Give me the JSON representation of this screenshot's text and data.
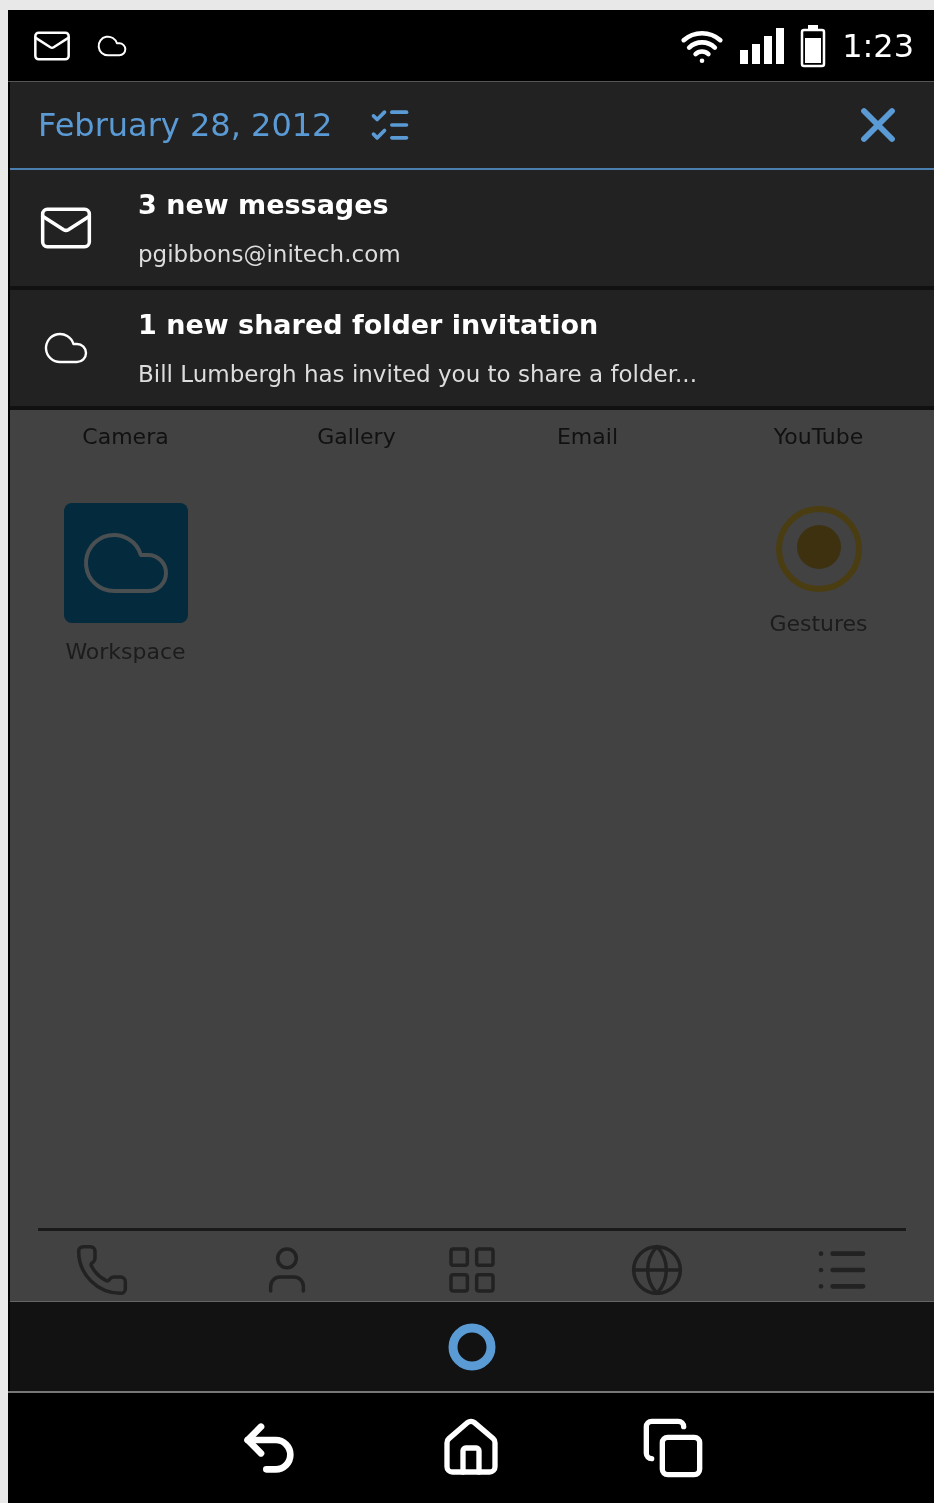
{
  "status_bar": {
    "time": "1:23"
  },
  "shade": {
    "date": "February 28, 2012",
    "notifications": [
      {
        "kind": "email",
        "title": "3 new messages",
        "subtitle": "pgibbons@initech.com"
      },
      {
        "kind": "cloud",
        "title": "1 new shared folder invitation",
        "subtitle": "Bill Lumbergh has invited you to share a folder..."
      }
    ]
  },
  "home": {
    "row_labels": [
      "Camera",
      "Gallery",
      "Email",
      "YouTube"
    ],
    "apps": [
      {
        "kind": "workspace",
        "label": "Workspace"
      },
      {
        "kind": "gestures",
        "label": "Gestures"
      }
    ]
  }
}
